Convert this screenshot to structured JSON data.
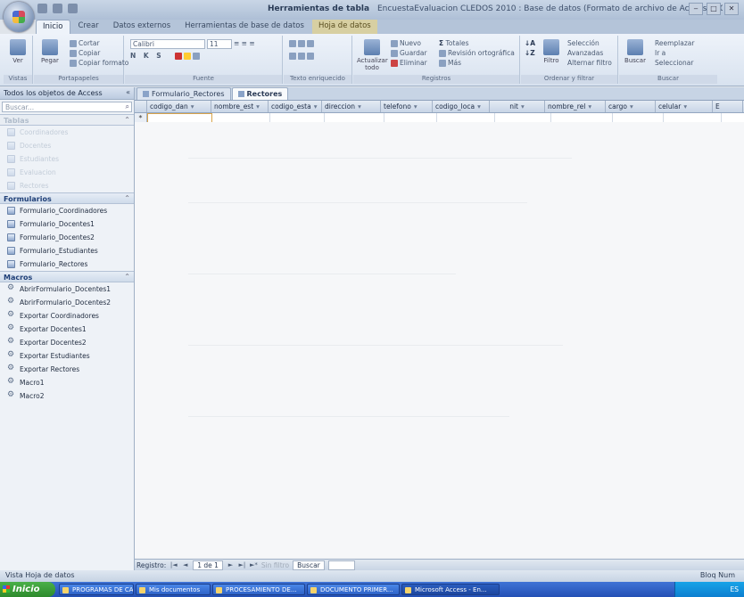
{
  "titlebar": {
    "context_label": "Herramientas de tabla",
    "title": "EncuestaEvaluacion CLEDOS 2010 : Base de datos (Formato de archivo de Access 2007) - Micr...",
    "minimize": "‒",
    "maximize": "□",
    "close": "✕"
  },
  "ribbon_tabs": [
    "Inicio",
    "Crear",
    "Datos externos",
    "Herramientas de base de datos",
    "Hoja de datos"
  ],
  "ribbon": {
    "view_label": "Ver",
    "paste_label": "Pegar",
    "cut_label": "Cortar",
    "copy_label": "Copiar",
    "format_painter_label": "Copiar formato",
    "font_name": "Calibri",
    "font_size": "11",
    "bold_italic": "N K S",
    "refresh_label": "Actualizar todo",
    "new_label": "Nuevo",
    "save_label": "Guardar",
    "delete_label": "Eliminar",
    "totals_label": "Totales",
    "spelling_label": "Revisión ortográfica",
    "more_label": "Más",
    "filter_label": "Filtro",
    "selection_label": "Selección",
    "advanced_label": "Avanzadas",
    "toggle_filter_label": "Alternar filtro",
    "find_label": "Buscar",
    "replace_label": "Reemplazar",
    "goto_label": "Ir a",
    "select_label": "Seleccionar",
    "groups": [
      "Vistas",
      "Portapapeles",
      "Fuente",
      "Texto enriquecido",
      "Registros",
      "Ordenar y filtrar",
      "Buscar"
    ]
  },
  "nav": {
    "header": "Todos los objetos de Access",
    "search_placeholder": "Buscar...",
    "sections": {
      "tables": "Tablas",
      "forms": "Formularios",
      "macros": "Macros"
    },
    "faded_tables": [
      "Coordinadores",
      "Docentes",
      "Estudiantes",
      "Evaluacion",
      "Rectores"
    ],
    "forms": [
      "Formulario_Coordinadores",
      "Formulario_Docentes1",
      "Formulario_Docentes2",
      "Formulario_Estudiantes",
      "Formulario_Rectores"
    ],
    "macros": [
      "AbrirFormulario_Docentes1",
      "AbrirFormulario_Docentes2",
      "Exportar Coordinadores",
      "Exportar Docentes1",
      "Exportar Docentes2",
      "Exportar Estudiantes",
      "Exportar Rectores",
      "Macro1",
      "Macro2"
    ]
  },
  "doc_tabs": [
    "Formulario_Rectores",
    "Rectores"
  ],
  "grid": {
    "columns": [
      "codigo_dan",
      "nombre_est",
      "codigo_esta",
      "direccion",
      "telefono",
      "codigo_loca",
      "nit",
      "nombre_rel",
      "cargo",
      "celular",
      "E"
    ],
    "new_row_marker": "*"
  },
  "record_nav": {
    "label": "Registro:",
    "first": "|◄",
    "prev": "◄",
    "position": "1 de 1",
    "next": "►",
    "last": "►|",
    "new": "►*",
    "filter": "Sin filtro",
    "search": "Buscar"
  },
  "status": {
    "left": "Vista Hoja de datos",
    "right": "Bloq Num"
  },
  "taskbar": {
    "start": "Inicio",
    "buttons": [
      "PROGRAMAS DE CAP...",
      "Mis documentos",
      "PROCESAMIENTO DE...",
      "DOCUMENTO PRIMER...",
      "Microsoft Access - En..."
    ],
    "tray": "ES"
  }
}
